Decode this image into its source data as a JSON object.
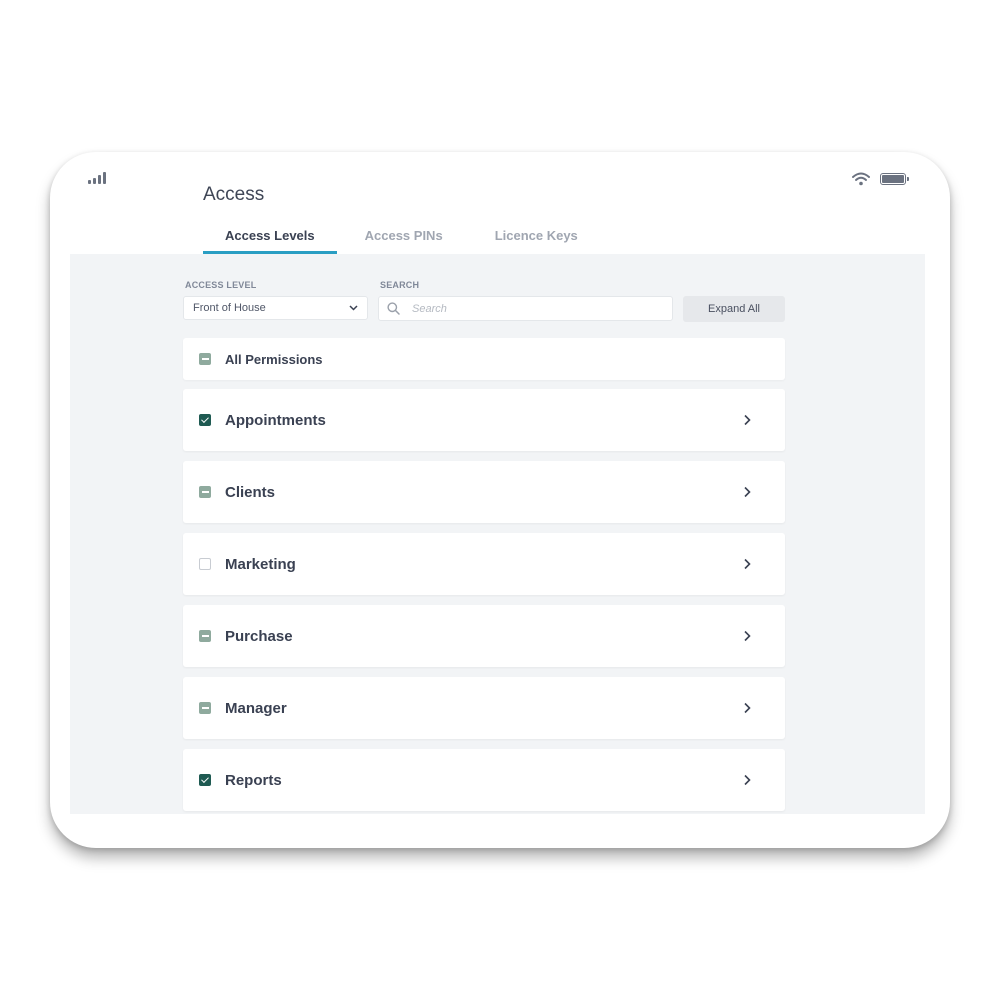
{
  "page": {
    "title": "Access"
  },
  "tabs": [
    {
      "label": "Access Levels",
      "active": true
    },
    {
      "label": "Access PINs",
      "active": false
    },
    {
      "label": "Licence Keys",
      "active": false
    }
  ],
  "filters": {
    "access_level_label": "ACCESS LEVEL",
    "access_level_value": "Front of House",
    "search_label": "SEARCH",
    "search_placeholder": "Search",
    "expand_all_label": "Expand All"
  },
  "permissions": {
    "all": {
      "label": "All Permissions",
      "state": "partial"
    },
    "items": [
      {
        "label": "Appointments",
        "state": "checked"
      },
      {
        "label": "Clients",
        "state": "partial"
      },
      {
        "label": "Marketing",
        "state": "empty"
      },
      {
        "label": "Purchase",
        "state": "partial"
      },
      {
        "label": "Manager",
        "state": "partial"
      },
      {
        "label": "Reports",
        "state": "checked"
      }
    ]
  },
  "icons": {
    "signal": "signal-bars-icon",
    "wifi": "wifi-icon",
    "battery": "battery-icon",
    "search": "search-icon",
    "dropdown": "chevron-down-icon",
    "row_arrow": "chevron-right-icon"
  },
  "colors": {
    "accent": "#2a9ec3",
    "checkbox_checked": "#1f5a52",
    "checkbox_partial": "#8faa9e",
    "content_bg": "#f2f4f6"
  }
}
